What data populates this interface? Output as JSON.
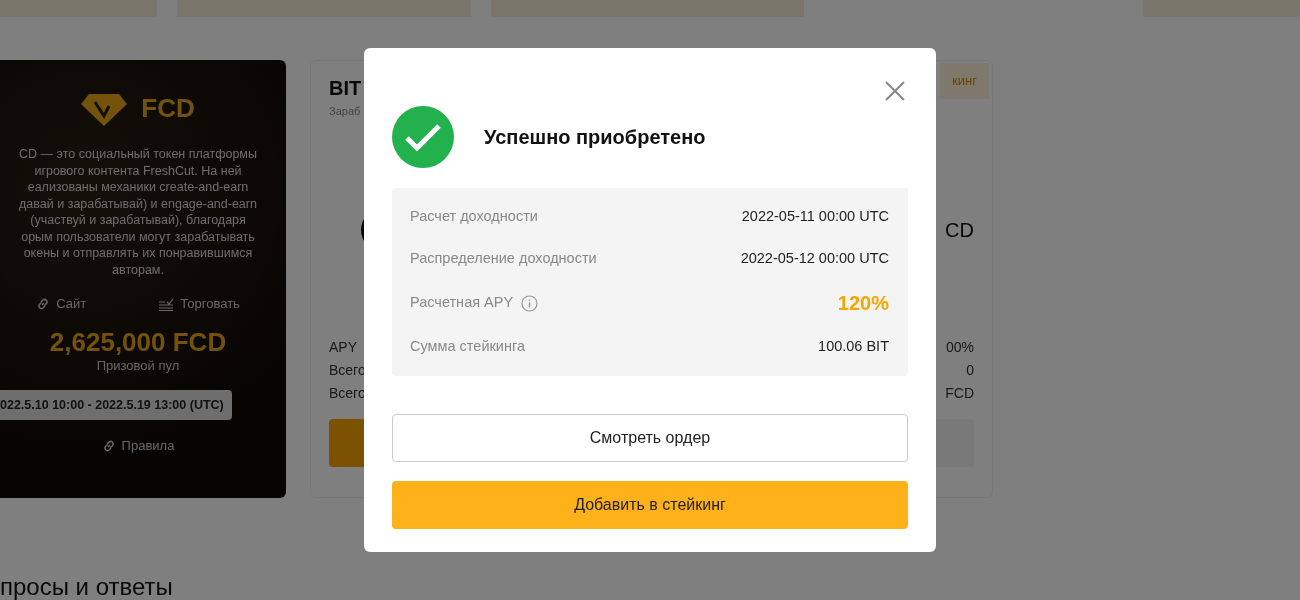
{
  "background_page": {
    "project_card": {
      "token": "FCD",
      "description_lines": [
        "CD — это социальный токен платформы",
        "игрового контента FreshCut. На ней",
        "еализованы механики create-and-earn",
        "давай и зарабатывай) и engage-and-earn",
        "(участвуй и зарабатывай), благодаря",
        "орым пользователи могут зарабатывать",
        "окены и отправлять их понравившимся",
        "авторам."
      ],
      "links": [
        {
          "kind": "link",
          "label": "Сайт"
        },
        {
          "kind": "trade",
          "label": "Торговать"
        }
      ],
      "prize_amount": "2,625,000 FCD",
      "prize_label": "Призовой пул",
      "period": "022.5.10 10:00 - 2022.5.19 13:00 (UTC)",
      "rules_link": "Правила"
    },
    "staking_card": {
      "title": "BIT",
      "subtitle": "Зараб",
      "badge": "кинг",
      "token_name": "CD",
      "stats": [
        {
          "label": "APY",
          "value": "00%"
        },
        {
          "label": "Всего",
          "value": "0"
        },
        {
          "label": "Всего",
          "value": "FCD"
        }
      ]
    },
    "faq_heading": "просы и ответы"
  },
  "modal": {
    "title": "Успешно приобретено",
    "details": [
      {
        "label": "Расчет доходности",
        "value": "2022-05-11 00:00 UTC",
        "info": false,
        "kind": "plain"
      },
      {
        "label": "Распределение доходности",
        "value": "2022-05-12 00:00 UTC",
        "info": false,
        "kind": "plain"
      },
      {
        "label": "Расчетная APY",
        "value": "120%",
        "info": true,
        "kind": "highlight"
      },
      {
        "label": "Сумма стейкинга",
        "value": "100.06 BIT",
        "info": false,
        "kind": "plain"
      }
    ],
    "buttons": [
      {
        "kind": "outline",
        "label": "Смотреть ордер"
      },
      {
        "kind": "primary",
        "label": "Добавить в стейкинг"
      }
    ]
  }
}
